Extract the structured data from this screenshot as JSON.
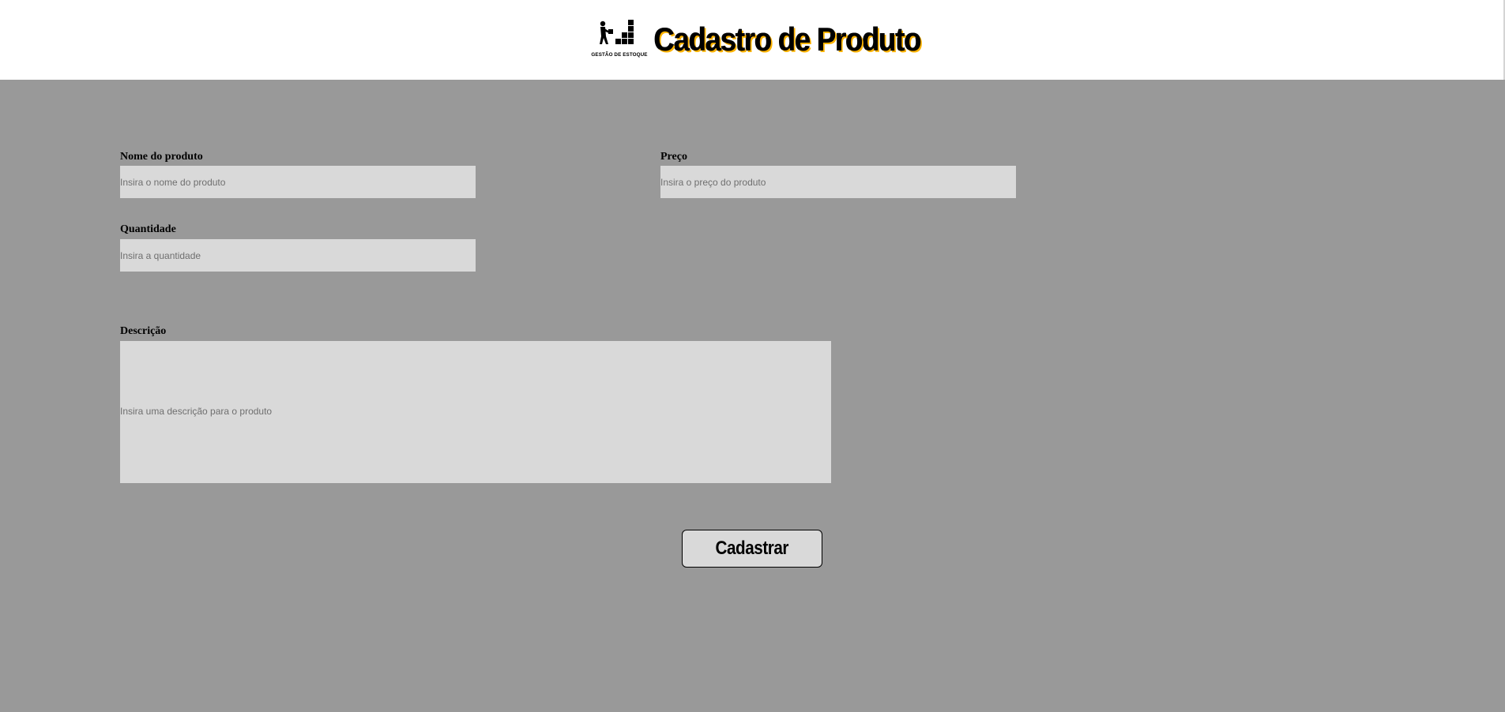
{
  "header": {
    "logo_caption": "GESTÃO DE ESTOQUE",
    "title": "Cadastro de Produto"
  },
  "form": {
    "nome": {
      "label": "Nome do produto",
      "placeholder": "Insira o nome do produto",
      "value": ""
    },
    "preco": {
      "label": "Preço",
      "placeholder": "Insira o preço do produto",
      "value": ""
    },
    "quantidade": {
      "label": "Quantidade",
      "placeholder": "Insira a quantidade",
      "value": ""
    },
    "descricao": {
      "label": "Descrição",
      "placeholder": "Insira uma descrição para o produto",
      "value": ""
    },
    "submit_label": "Cadastrar"
  },
  "colors": {
    "page_background": "#999999",
    "header_background": "#ffffff",
    "input_background": "#d9d9d9",
    "title_shadow": "#ffb300"
  },
  "icons": {
    "logo": "worker-stacking-boxes-icon"
  }
}
